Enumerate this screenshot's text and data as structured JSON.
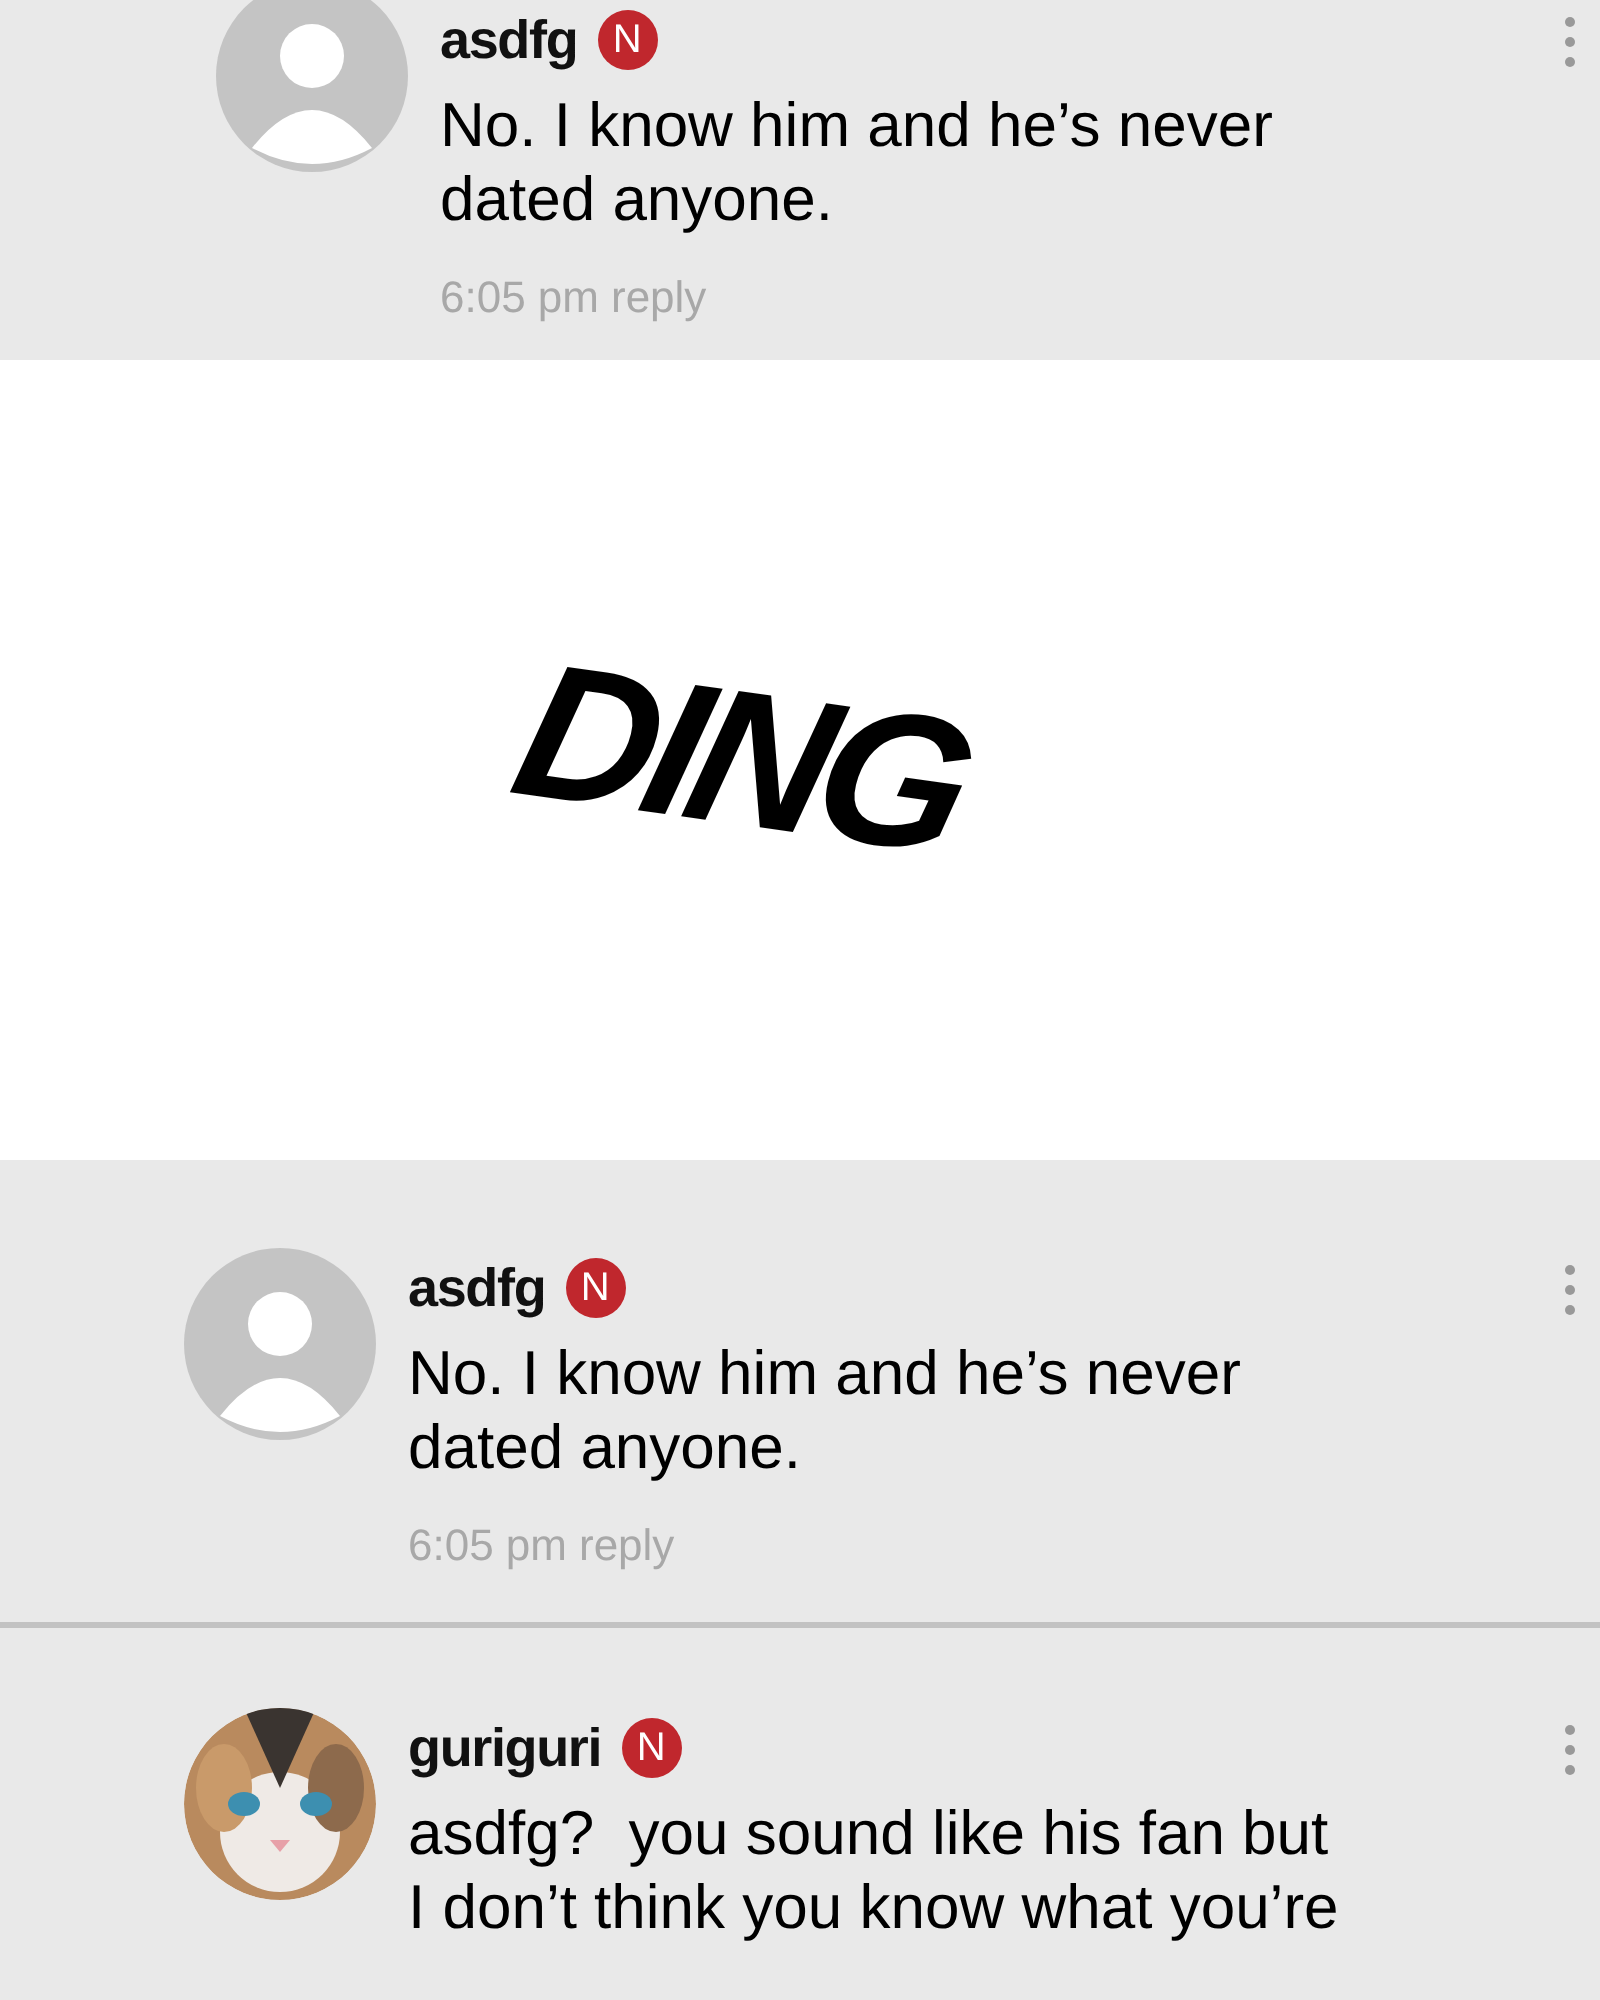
{
  "top_comment": {
    "author": "asdfg",
    "badge": "N",
    "avatar": {
      "kind": "placeholder"
    },
    "lines": [
      "No. I know him and he’s never",
      "dated anyone."
    ],
    "time": "6:05 pm",
    "action": "reply"
  },
  "sound_effect": "DING",
  "comments": [
    {
      "author": "asdfg",
      "badge": "N",
      "avatar": {
        "kind": "placeholder"
      },
      "lines": [
        "No. I know him and he’s never",
        "dated anyone."
      ],
      "time": "6:05 pm",
      "action": "reply"
    },
    {
      "author": "guriguri",
      "badge": "N",
      "lines": [
        "asdfg?  you sound like his fan but",
        "I don’t think you know what you’re"
      ]
    }
  ]
}
